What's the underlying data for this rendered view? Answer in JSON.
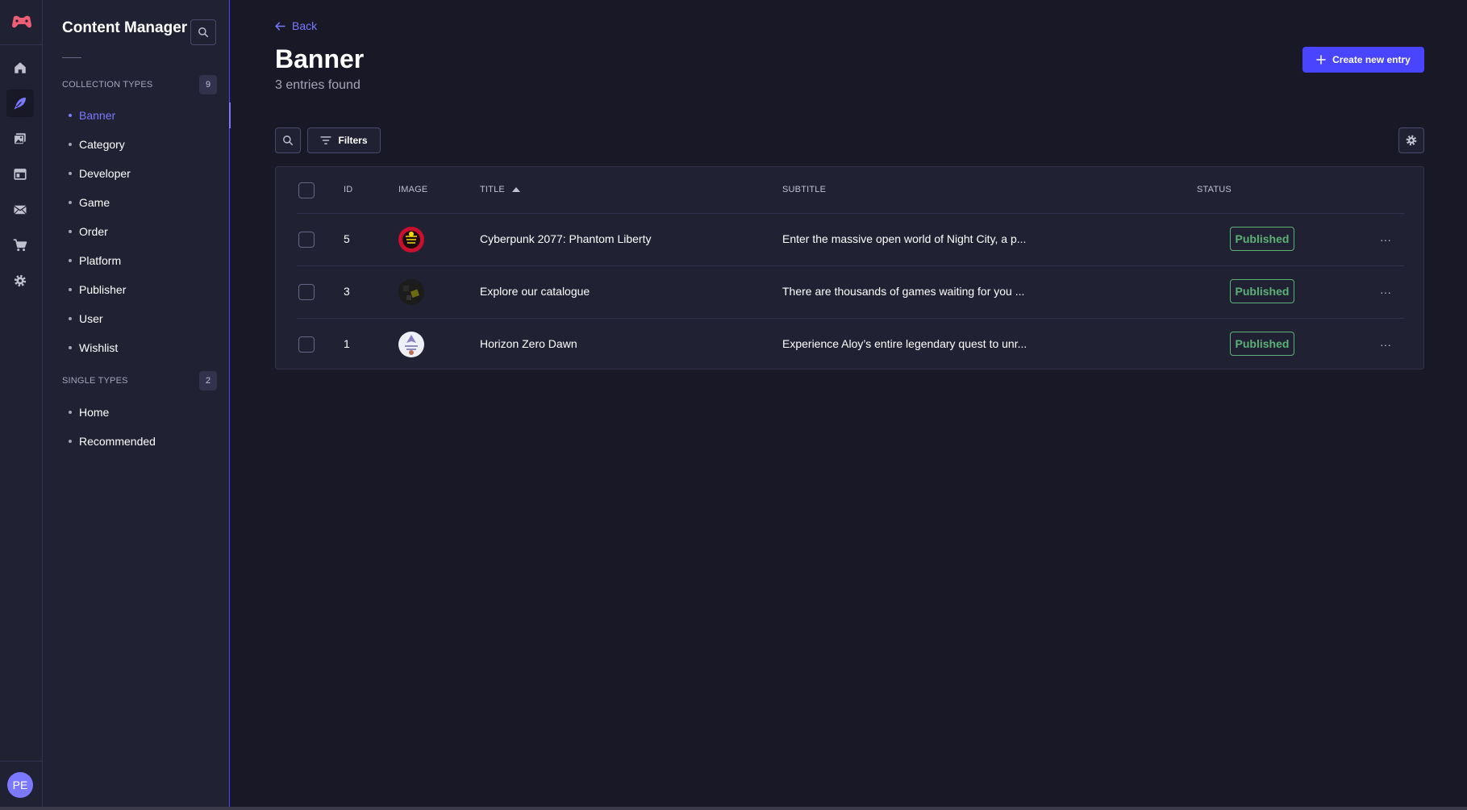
{
  "app": {
    "user_initials": "PE",
    "accent": "#7b79ff",
    "primary": "#4945ff",
    "success": "#5cb176"
  },
  "rail": {
    "icons": [
      "logo-icon",
      "home-icon",
      "content-manager-icon",
      "media-library-icon",
      "layout-icon",
      "email-icon",
      "cart-icon",
      "settings-icon"
    ]
  },
  "subnav": {
    "title": "Content Manager",
    "collection_types": {
      "label": "COLLECTION TYPES",
      "count": "9",
      "items": [
        "Banner",
        "Category",
        "Developer",
        "Game",
        "Order",
        "Platform",
        "Publisher",
        "User",
        "Wishlist"
      ]
    },
    "single_types": {
      "label": "SINGLE TYPES",
      "count": "2",
      "items": [
        "Home",
        "Recommended"
      ]
    }
  },
  "header": {
    "back_label": "Back",
    "title": "Banner",
    "subtitle": "3 entries found",
    "create_label": "Create new entry",
    "filters_label": "Filters"
  },
  "table": {
    "columns": {
      "id": "ID",
      "image": "IMAGE",
      "title": "TITLE",
      "subtitle": "SUBTITLE",
      "status": "STATUS"
    },
    "rows": [
      {
        "id": "5",
        "title": "Cyberpunk 2077: Phantom Liberty",
        "subtitle": "Enter the massive open world of Night City, a p...",
        "status": "Published",
        "more": "···"
      },
      {
        "id": "3",
        "title": "Explore our catalogue",
        "subtitle": "There are thousands of games waiting for you ...",
        "status": "Published",
        "more": "···"
      },
      {
        "id": "1",
        "title": "Horizon Zero Dawn",
        "subtitle": "Experience Aloy’s entire legendary quest to unr...",
        "status": "Published",
        "more": "···"
      }
    ]
  }
}
